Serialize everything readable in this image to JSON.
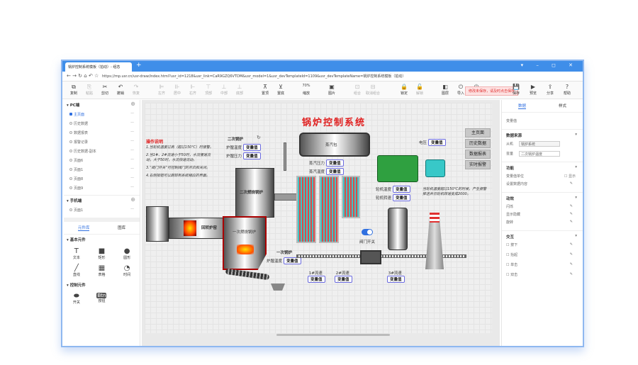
{
  "browser": {
    "tab_title": "锅炉控制系统模板（拍动）- 组态",
    "url": "https://mp.usr.cn/usr-draw/index.html?usr_id=1218&usr_link=CaR9GZQ6VTDM&usr_model=1&usr_devTemplateId=1109&usr_devTemplateName=锅炉控制系统模板（拍动）"
  },
  "toolbar": {
    "items": [
      "复制",
      "粘贴",
      "剪切",
      "撤销",
      "恢复",
      "左齐",
      "居中",
      "右齐",
      "顶部",
      "中部",
      "底部",
      "置顶",
      "置底",
      "缩放",
      "图片",
      "组合",
      "取消组合",
      "锁定",
      "解锁",
      "图层",
      "导入",
      "导出"
    ],
    "zoom": "70%",
    "save_hint": "修改未保存，请及时点击保存",
    "right": [
      "保存",
      "预览",
      "分享",
      "帮助"
    ]
  },
  "left": {
    "pc_title": "PC端",
    "pc_pages": [
      "主页面",
      "历史数据",
      "数据报表",
      "报警记录",
      "历史数据-副本",
      "页面6",
      "页面1",
      "页面8",
      "页面9"
    ],
    "mobile_title": "手机端",
    "mobile_pages": [
      "页面1"
    ],
    "tabs": [
      "元件库",
      "图库"
    ],
    "basic_title": "基本元件",
    "basic": [
      "文本",
      "矩形",
      "圆形",
      "直线",
      "表格",
      "时间"
    ],
    "control_title": "控制元件",
    "control": [
      "开关",
      "按钮"
    ]
  },
  "diagram": {
    "title": "锅炉控制系统",
    "instr_title": "操作说明",
    "instr": [
      "1.当轮机温度过高（超过150℃）时报警。",
      "2.当1#、2#流速小于50时，水流慢速流动，大于50时，水流快速流动。",
      "3.“阀门开关”可控制阀门的开启和关闭。",
      "4.右侧按钮可以跳转到系统相应的界面。"
    ],
    "value": "变量值",
    "second_boiler": "二次锅炉",
    "furnace_temp": "炉膛温度",
    "furnace_pressure": "炉膛压力",
    "second_combustion": "二次燃烧锅炉",
    "steam_drum": "蒸汽包",
    "steam_pressure": "蒸汽压力",
    "steam_temp": "蒸汽温度",
    "voltage": "电压",
    "turbine_temp": "轮机温度",
    "turbine_speed": "轮机转速",
    "note": "当轮机温度超过150℃的时候，产生报警推送并且轮机转速变成2000。",
    "nav": [
      "主页面",
      "历史数据",
      "数据报表",
      "实时报警"
    ],
    "kiln": "回转炉窑",
    "first_combustion": "一次燃烧锅炉",
    "first_boiler": "一次锅炉",
    "valve": "阀门开关",
    "valve_on": true,
    "flow1": "1#流速",
    "flow2": "2#流速",
    "flow3": "3#流速"
  },
  "right": {
    "tabs": [
      "数据",
      "样式"
    ],
    "component": "变量值",
    "src_title": "数据来源",
    "slave_label": "从机",
    "slave": "锅炉系统",
    "var_label": "变量",
    "var": "二次锅炉温度",
    "func_title": "功能",
    "unit": "变量值单位",
    "show": "显示",
    "set_content": "设置数据内容",
    "anim_title": "动效",
    "anims": [
      "闪烁",
      "显示隐藏",
      "旋转"
    ],
    "inter_title": "交互",
    "inters": [
      "按下",
      "抬起",
      "单击",
      "双击"
    ]
  }
}
